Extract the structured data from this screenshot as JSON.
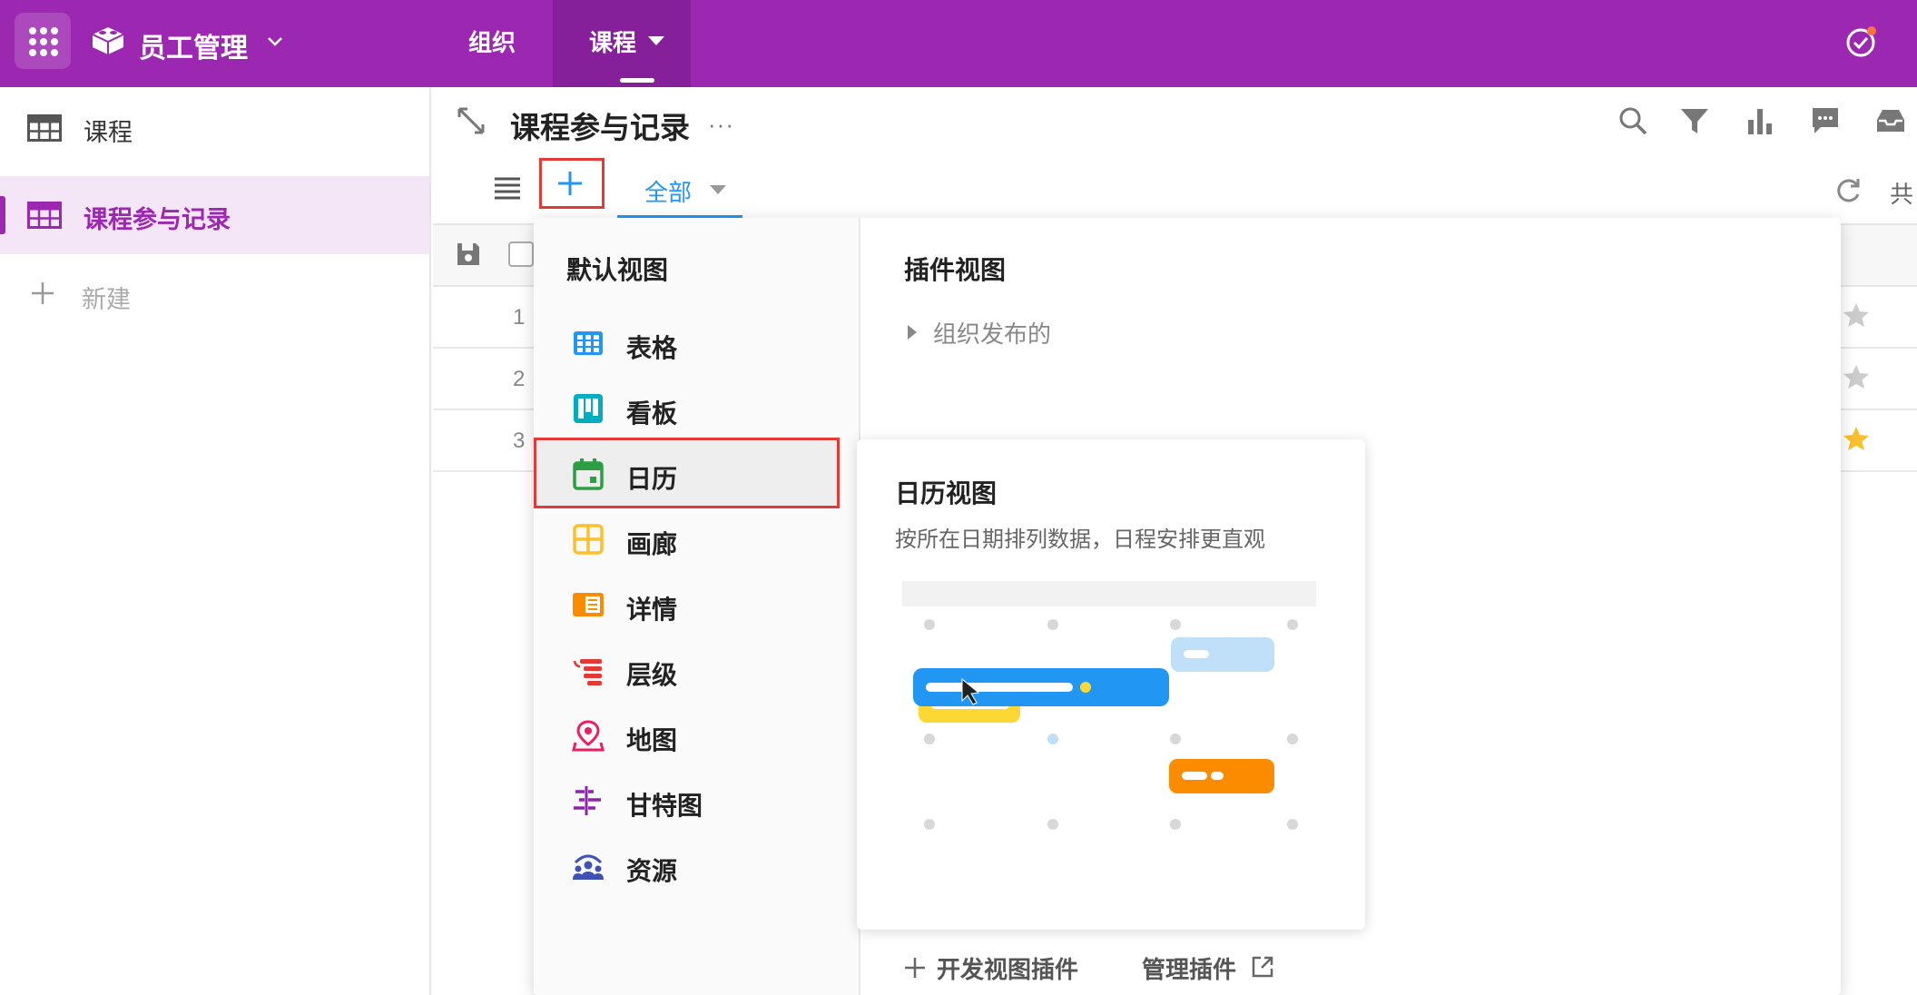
{
  "app": {
    "name": "员工管理"
  },
  "nav": {
    "tabs": [
      {
        "label": "组织"
      },
      {
        "label": "课程"
      }
    ]
  },
  "sidebar": {
    "items": [
      {
        "label": "课程"
      },
      {
        "label": "课程参与记录"
      }
    ],
    "new_label": "新建"
  },
  "sheet": {
    "title": "课程参与记录",
    "more": "···",
    "view_tab": "全部",
    "share_label": "共"
  },
  "table": {
    "rows": [
      {
        "num": "1",
        "starred": false
      },
      {
        "num": "2",
        "starred": false
      },
      {
        "num": "3",
        "starred": true
      }
    ]
  },
  "dropdown": {
    "default_heading": "默认视图",
    "views": [
      {
        "label": "表格",
        "icon": "table-grid-icon"
      },
      {
        "label": "看板",
        "icon": "kanban-icon"
      },
      {
        "label": "日历",
        "icon": "calendar-icon"
      },
      {
        "label": "画廊",
        "icon": "gallery-icon"
      },
      {
        "label": "详情",
        "icon": "detail-icon"
      },
      {
        "label": "层级",
        "icon": "hierarchy-icon"
      },
      {
        "label": "地图",
        "icon": "map-pin-icon"
      },
      {
        "label": "甘特图",
        "icon": "gantt-icon"
      },
      {
        "label": "资源",
        "icon": "resource-icon"
      }
    ],
    "selected_view": "日历",
    "plugin_heading": "插件视图",
    "plugin_group": "组织发布的",
    "footer_dev": "开发视图插件",
    "footer_manage": "管理插件"
  },
  "preview": {
    "title": "日历视图",
    "description": "按所在日期排列数据，日程安排更直观"
  },
  "colors": {
    "brand": "#9C27B0",
    "accent": "#2196F3",
    "highlight": "#e53935",
    "star": "#FBC02D"
  }
}
